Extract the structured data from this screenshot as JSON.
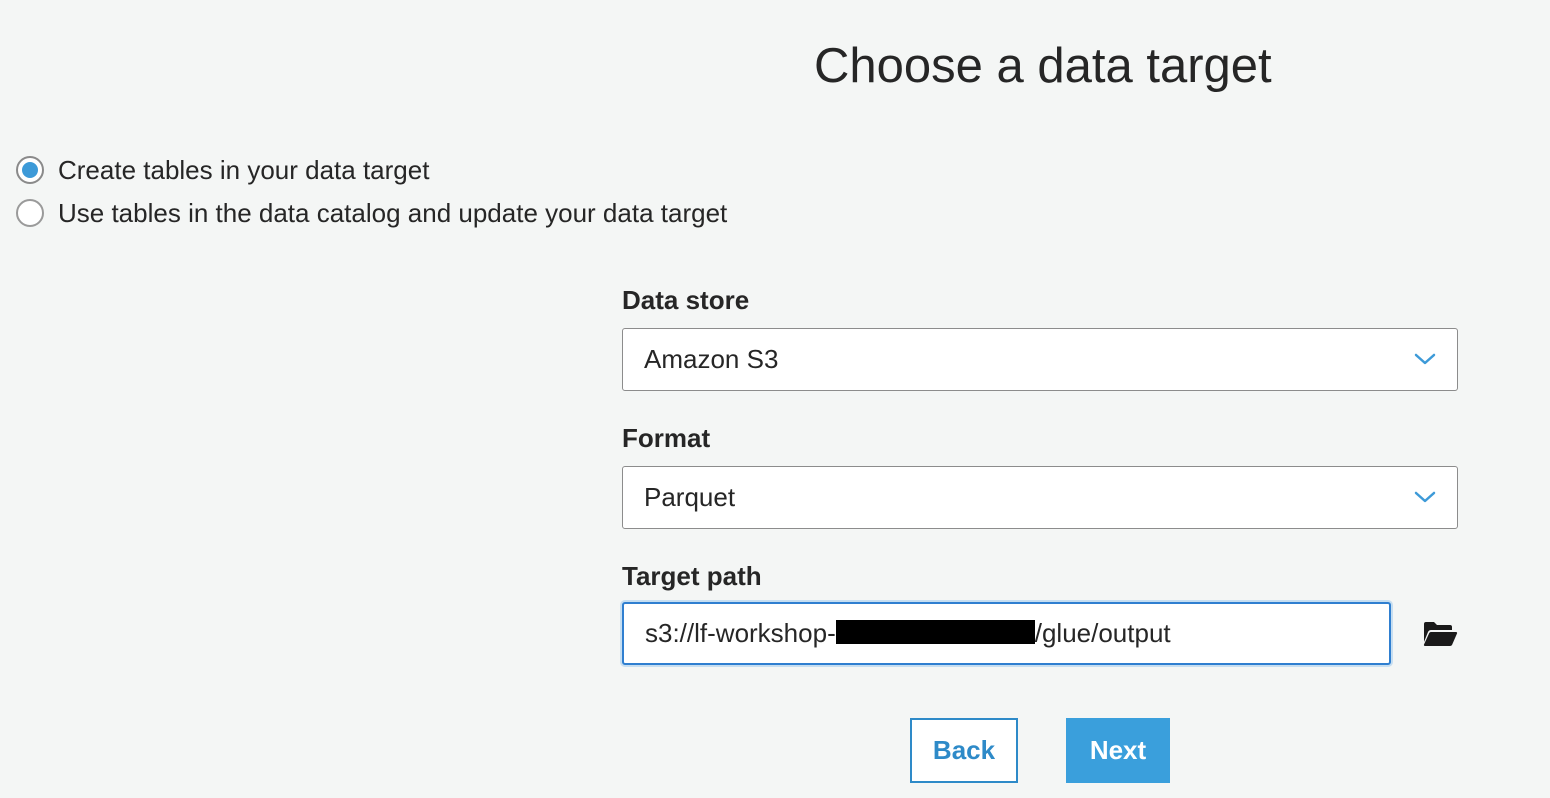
{
  "page": {
    "title": "Choose a data target"
  },
  "options": [
    {
      "label": "Create tables in your data target",
      "selected": true
    },
    {
      "label": "Use tables in the data catalog and update your data target",
      "selected": false
    }
  ],
  "form": {
    "data_store": {
      "label": "Data store",
      "value": "Amazon S3"
    },
    "format": {
      "label": "Format",
      "value": "Parquet"
    },
    "target_path": {
      "label": "Target path",
      "value_prefix": "s3://lf-workshop-",
      "value_suffix": "/glue/output"
    }
  },
  "buttons": {
    "back": "Back",
    "next": "Next"
  },
  "colors": {
    "accent": "#3a9fdc",
    "background": "#f4f6f5",
    "focus_border": "#2f7fd0"
  },
  "icons": {
    "dropdown": "chevron-down-icon",
    "browse": "folder-open-icon"
  }
}
